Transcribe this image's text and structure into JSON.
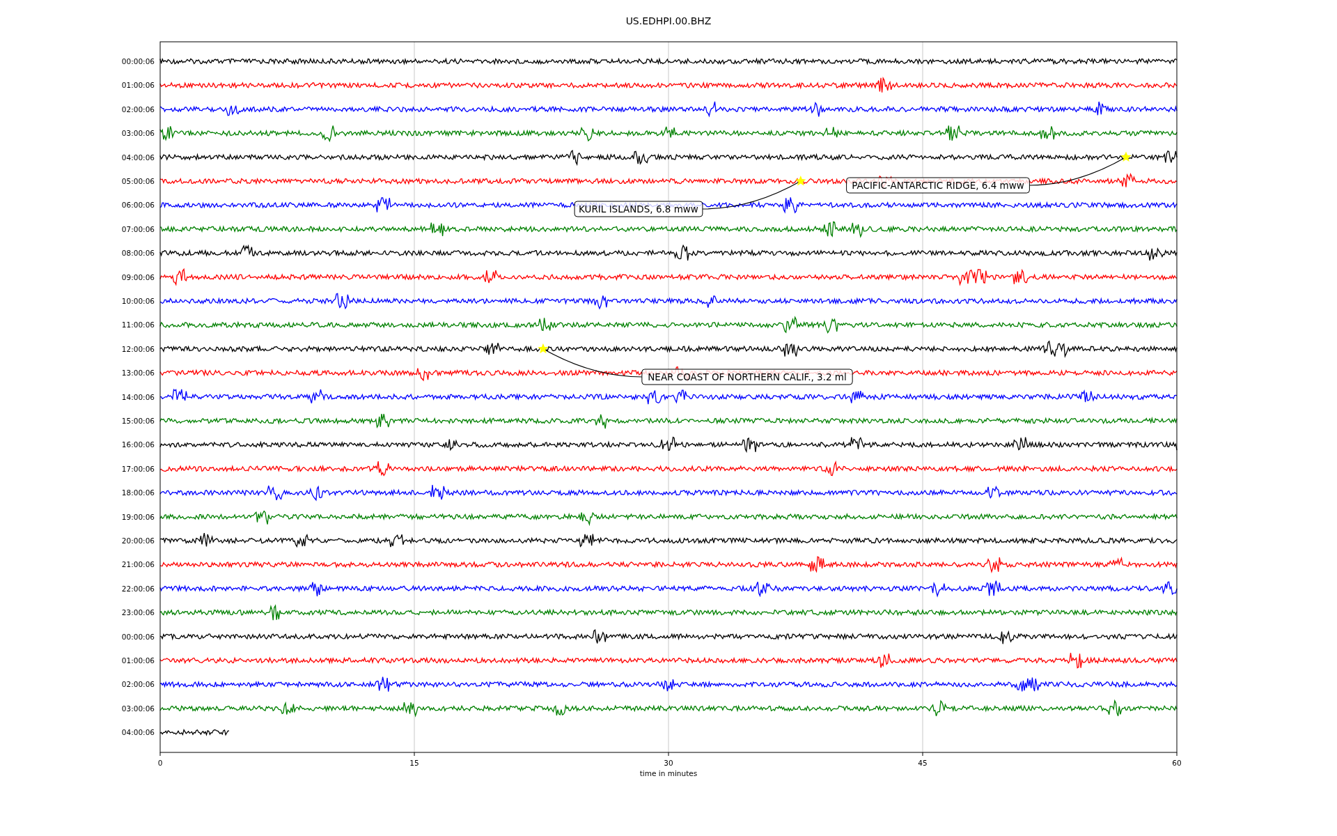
{
  "title": "US.EDHPI.00.BHZ",
  "traces": [
    {
      "label": "00:00:06",
      "color": "#000000",
      "level": 1
    },
    {
      "label": "01:00:06",
      "color": "#ff0000",
      "level": 1
    },
    {
      "label": "02:00:06",
      "color": "#0000ff",
      "level": 1
    },
    {
      "label": "03:00:06",
      "color": "#008000",
      "level": 1
    },
    {
      "label": "04:00:06",
      "color": "#000000",
      "level": 1
    },
    {
      "label": "05:00:06",
      "color": "#ff0000",
      "level": 1
    },
    {
      "label": "06:00:06",
      "color": "#0000ff",
      "level": 1
    },
    {
      "label": "07:00:06",
      "color": "#008000",
      "level": 1
    },
    {
      "label": "08:00:06",
      "color": "#000000",
      "level": 1
    },
    {
      "label": "09:00:06",
      "color": "#ff0000",
      "level": 1
    },
    {
      "label": "10:00:06",
      "color": "#0000ff",
      "level": 1
    },
    {
      "label": "11:00:06",
      "color": "#008000",
      "level": 1
    },
    {
      "label": "12:00:06",
      "color": "#000000",
      "level": 1
    },
    {
      "label": "13:00:06",
      "color": "#ff0000",
      "level": 1
    },
    {
      "label": "14:00:06",
      "color": "#0000ff",
      "level": 1
    },
    {
      "label": "15:00:06",
      "color": "#008000",
      "level": 1
    },
    {
      "label": "16:00:06",
      "color": "#000000",
      "level": 1
    },
    {
      "label": "17:00:06",
      "color": "#ff0000",
      "level": 1
    },
    {
      "label": "18:00:06",
      "color": "#0000ff",
      "level": 1
    },
    {
      "label": "19:00:06",
      "color": "#008000",
      "level": 1
    },
    {
      "label": "20:00:06",
      "color": "#000000",
      "level": 1
    },
    {
      "label": "21:00:06",
      "color": "#ff0000",
      "level": 1
    },
    {
      "label": "22:00:06",
      "color": "#0000ff",
      "level": 1
    },
    {
      "label": "23:00:06",
      "color": "#008000",
      "level": 1
    },
    {
      "label": "00:00:06",
      "color": "#000000",
      "level": 1
    },
    {
      "label": "01:00:06",
      "color": "#ff0000",
      "level": 1
    },
    {
      "label": "02:00:06",
      "color": "#0000ff",
      "level": 1
    },
    {
      "label": "03:00:06",
      "color": "#008000",
      "level": 1
    },
    {
      "label": "04:00:06",
      "color": "#000000",
      "level": 0.068
    }
  ],
  "x_ticks": [
    "0",
    "15",
    "30",
    "45",
    "60"
  ],
  "xlabel": "time in minutes",
  "annotations": [
    {
      "text": "KURIL ISLANDS, 6.8 mww"
    },
    {
      "text": "PACIFIC-ANTARCTIC RIDGE, 6.4 mww"
    },
    {
      "text": "NEAR COAST OF NORTHERN CALIF., 3.2 ml"
    }
  ]
}
